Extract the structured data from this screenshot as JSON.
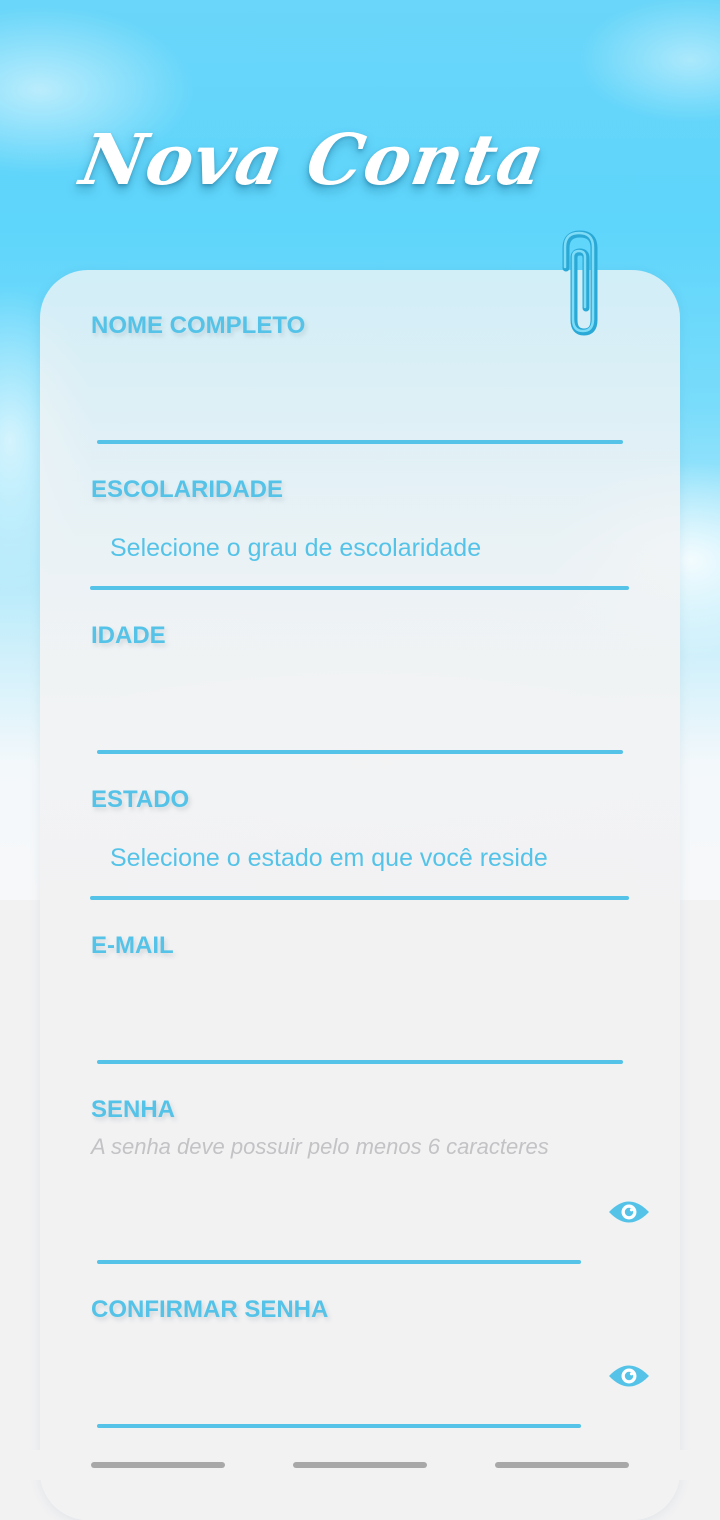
{
  "header": {
    "title": "Nova Conta"
  },
  "form": {
    "full_name": {
      "label": "NOME COMPLETO",
      "value": ""
    },
    "education": {
      "label": "ESCOLARIDADE",
      "placeholder": "Selecione o grau de escolaridade"
    },
    "age": {
      "label": "IDADE",
      "value": ""
    },
    "state": {
      "label": "ESTADO",
      "placeholder": "Selecione o estado em que você reside"
    },
    "email": {
      "label": "E-MAIL",
      "value": ""
    },
    "password": {
      "label": "SENHA",
      "hint": "A senha deve possuir pelo menos 6 caracteres",
      "value": ""
    },
    "confirm_password": {
      "label": "CONFIRMAR SENHA",
      "value": ""
    }
  },
  "icons": {
    "clip": "paperclip-icon",
    "show_password": "eye-icon"
  },
  "colors": {
    "accent": "#55c3e8",
    "hint": "#c3c3c6",
    "card": "#f2f2f3",
    "sky": "#5ed5fb"
  }
}
